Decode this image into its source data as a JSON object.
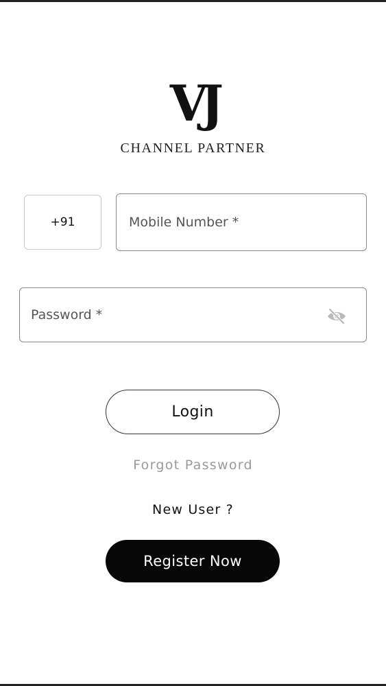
{
  "brand": {
    "logo_mark": "VJ",
    "subtitle": "CHANNEL PARTNER"
  },
  "form": {
    "country_code": "+91",
    "mobile_placeholder": "Mobile Number *",
    "mobile_value": "",
    "password_placeholder": "Password *",
    "password_value": "",
    "password_visibility_icon": "eye-off-icon"
  },
  "actions": {
    "login_label": "Login",
    "forgot_password_label": "Forgot Password",
    "new_user_text": "New User ?",
    "register_label": "Register Now"
  },
  "colors": {
    "primary_button": "#070707",
    "muted_link": "#9a9a9a"
  }
}
